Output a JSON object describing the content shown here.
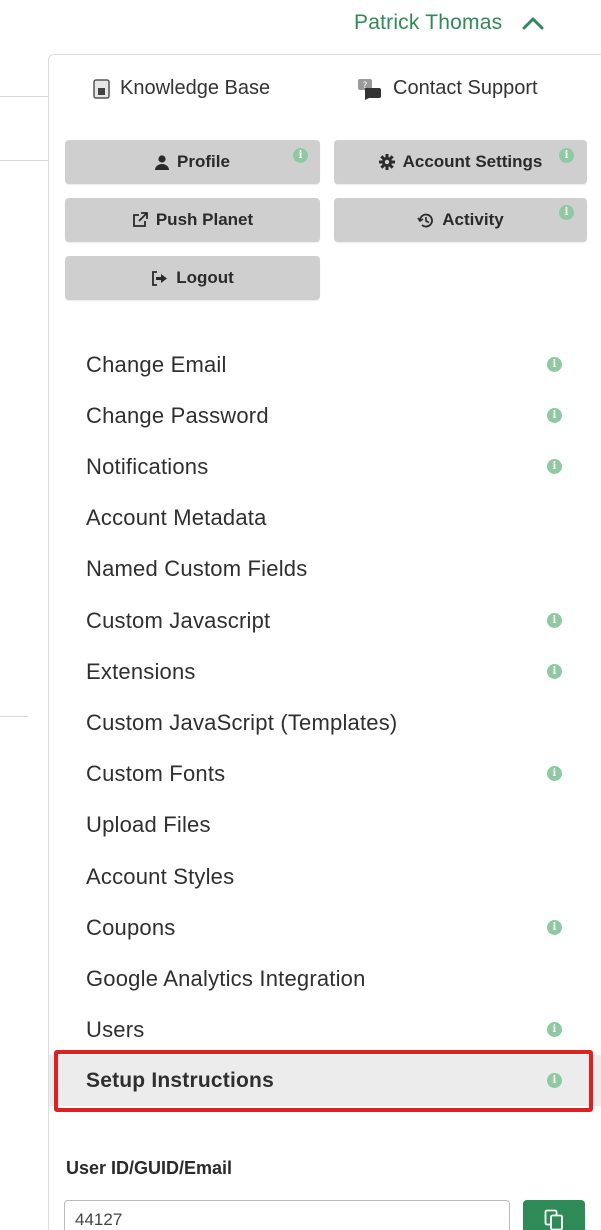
{
  "header": {
    "user_name": "Patrick Thomas"
  },
  "help": {
    "knowledge_base": "Knowledge Base",
    "contact_support": "Contact Support"
  },
  "buttons": {
    "profile": "Profile",
    "account_settings": "Account Settings",
    "push_planet": "Push Planet",
    "activity": "Activity",
    "logout": "Logout"
  },
  "menu": {
    "items": [
      {
        "label": "Change Email",
        "info": true
      },
      {
        "label": "Change Password",
        "info": true
      },
      {
        "label": "Notifications",
        "info": true
      },
      {
        "label": "Account Metadata",
        "info": false
      },
      {
        "label": "Named Custom Fields",
        "info": false
      },
      {
        "label": "Custom Javascript",
        "info": true
      },
      {
        "label": "Extensions",
        "info": true
      },
      {
        "label": "Custom JavaScript (Templates)",
        "info": false
      },
      {
        "label": "Custom Fonts",
        "info": true
      },
      {
        "label": "Upload Files",
        "info": false
      },
      {
        "label": "Account Styles",
        "info": false
      },
      {
        "label": "Coupons",
        "info": true
      },
      {
        "label": "Google Analytics Integration",
        "info": false
      },
      {
        "label": "Users",
        "info": true
      },
      {
        "label": "Setup Instructions",
        "info": true,
        "active": true
      }
    ]
  },
  "info_badge": "i",
  "user_id": {
    "label": "User ID/GUID/Email",
    "value": "44127"
  },
  "colors": {
    "accent": "#2e8b57",
    "info_badge": "#8fc9a1",
    "button_bg": "#cfcfcf",
    "highlight": "#e0201f"
  }
}
